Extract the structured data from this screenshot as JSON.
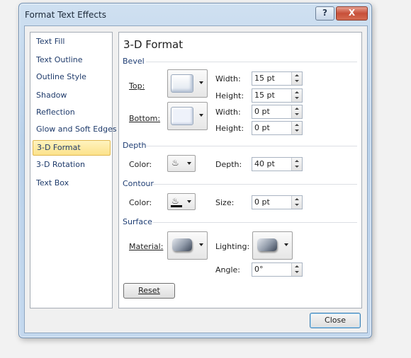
{
  "window": {
    "title": "Format Text Effects",
    "help_label": "?",
    "close_label": "X"
  },
  "nav": {
    "items": [
      {
        "label": "Text Fill"
      },
      {
        "label": "Text Outline"
      },
      {
        "label": "Outline Style"
      },
      {
        "label": "Shadow"
      },
      {
        "label": "Reflection"
      },
      {
        "label": "Glow and Soft Edges"
      },
      {
        "label": "3-D Format",
        "selected": true
      },
      {
        "label": "3-D Rotation"
      },
      {
        "label": "Text Box"
      }
    ]
  },
  "panel": {
    "title": "3-D Format",
    "bevel": {
      "heading": "Bevel",
      "top_label": "Top:",
      "bottom_label": "Bottom:",
      "top_width_label": "Width:",
      "top_width_value": "15 pt",
      "top_height_label": "Height:",
      "top_height_value": "15 pt",
      "bottom_width_label": "Width:",
      "bottom_width_value": "0 pt",
      "bottom_height_label": "Height:",
      "bottom_height_value": "0 pt"
    },
    "depth": {
      "heading": "Depth",
      "color_label": "Color:",
      "depth_label": "Depth:",
      "depth_value": "40 pt"
    },
    "contour": {
      "heading": "Contour",
      "color_label": "Color:",
      "size_label": "Size:",
      "size_value": "0 pt"
    },
    "surface": {
      "heading": "Surface",
      "material_label": "Material:",
      "lighting_label": "Lighting:",
      "angle_label": "Angle:",
      "angle_value": "0°"
    },
    "reset_label": "Reset"
  },
  "footer": {
    "close_label": "Close"
  },
  "colors": {
    "selection_bg": "#fce28a",
    "section_heading": "#1e3d73",
    "window_frame": "#b9d1ea"
  }
}
